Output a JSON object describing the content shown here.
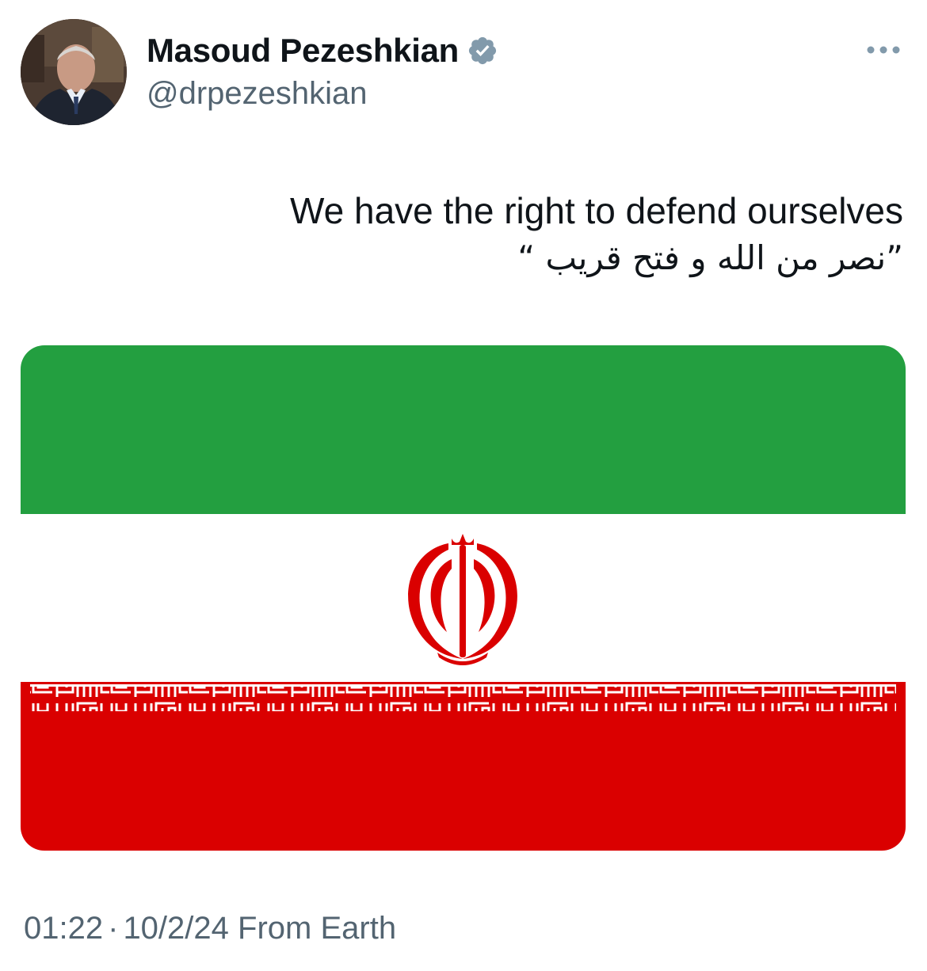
{
  "author": {
    "display_name": "Masoud Pezeshkian",
    "handle": "@drpezeshkian",
    "verified_icon": "verified-badge-icon",
    "avatar_icon": "avatar-photo"
  },
  "actions": {
    "more_icon": "more-horizontal-icon"
  },
  "tweet": {
    "text_line1": "We have the right to defend ourselves",
    "text_line2": "”نصر من الله و فتح قريب “"
  },
  "media": {
    "description_icon": "iran-flag-image",
    "colors": {
      "green": "#239f40",
      "white": "#ffffff",
      "red": "#da0000"
    }
  },
  "meta": {
    "time": "01:22",
    "separator": "·",
    "date": "10/2/24",
    "source": "From Earth"
  },
  "colors": {
    "text_primary": "#0f1419",
    "text_secondary": "#536471",
    "verified": "#829aab"
  }
}
